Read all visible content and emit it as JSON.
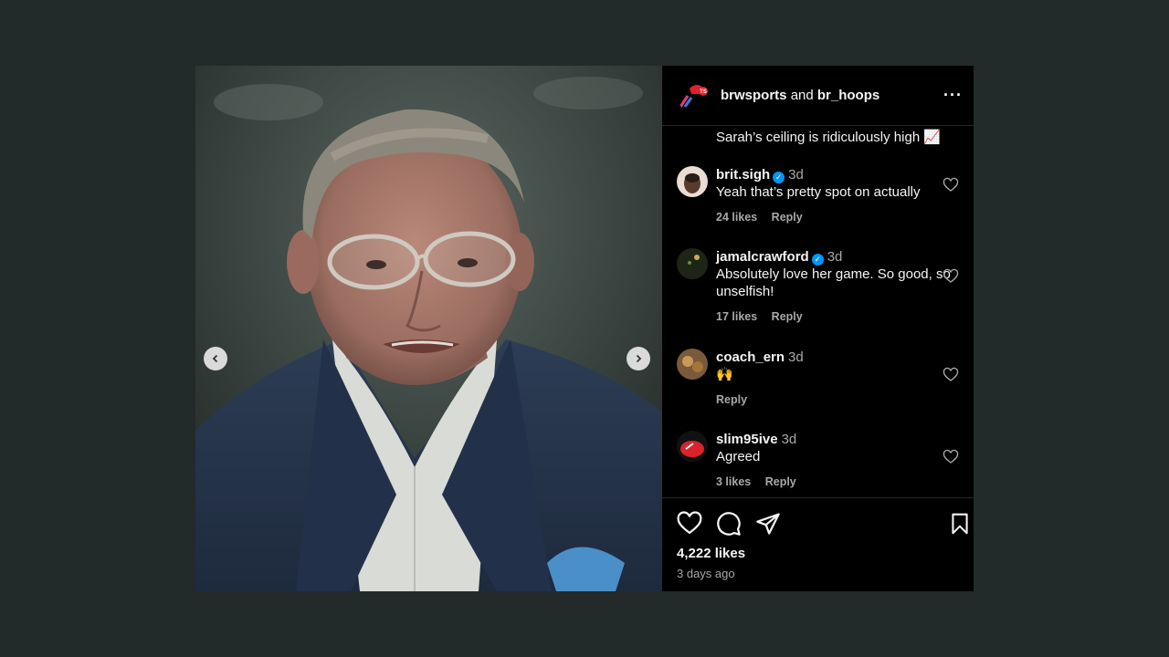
{
  "post": {
    "author_primary": "brwsports",
    "joiner": "and",
    "author_secondary": "br_hoops",
    "more": "···"
  },
  "caption_tail": "Sarah’s ceiling is ridiculously high 📈",
  "comments": [
    {
      "user": "brit.sigh",
      "verified": true,
      "time": "3d",
      "text": "Yeah that’s pretty spot on actually",
      "likes": "24 likes",
      "reply": "Reply"
    },
    {
      "user": "jamalcrawford",
      "verified": true,
      "time": "3d",
      "text": "Absolutely love her game. So good, so unselfish!",
      "likes": "17 likes",
      "reply": "Reply"
    },
    {
      "user": "coach_ern",
      "verified": false,
      "time": "3d",
      "text": "🙌",
      "likes": "",
      "reply": "Reply"
    },
    {
      "user": "slim95ive",
      "verified": false,
      "time": "3d",
      "text": "Agreed",
      "likes": "3 likes",
      "reply": "Reply"
    }
  ],
  "footer": {
    "likes": "4,222 likes",
    "posted": "3 days ago"
  },
  "icons": {
    "like": "heart-icon",
    "comment": "comment-icon",
    "share": "share-icon",
    "save": "bookmark-icon",
    "prev": "chevron-left-icon",
    "next": "chevron-right-icon",
    "verified": "verified-badge-icon"
  },
  "colors": {
    "background": "#232a2a",
    "panel": "#000000",
    "verified": "#0095f6",
    "secondary_text": "#a8a8a8"
  }
}
